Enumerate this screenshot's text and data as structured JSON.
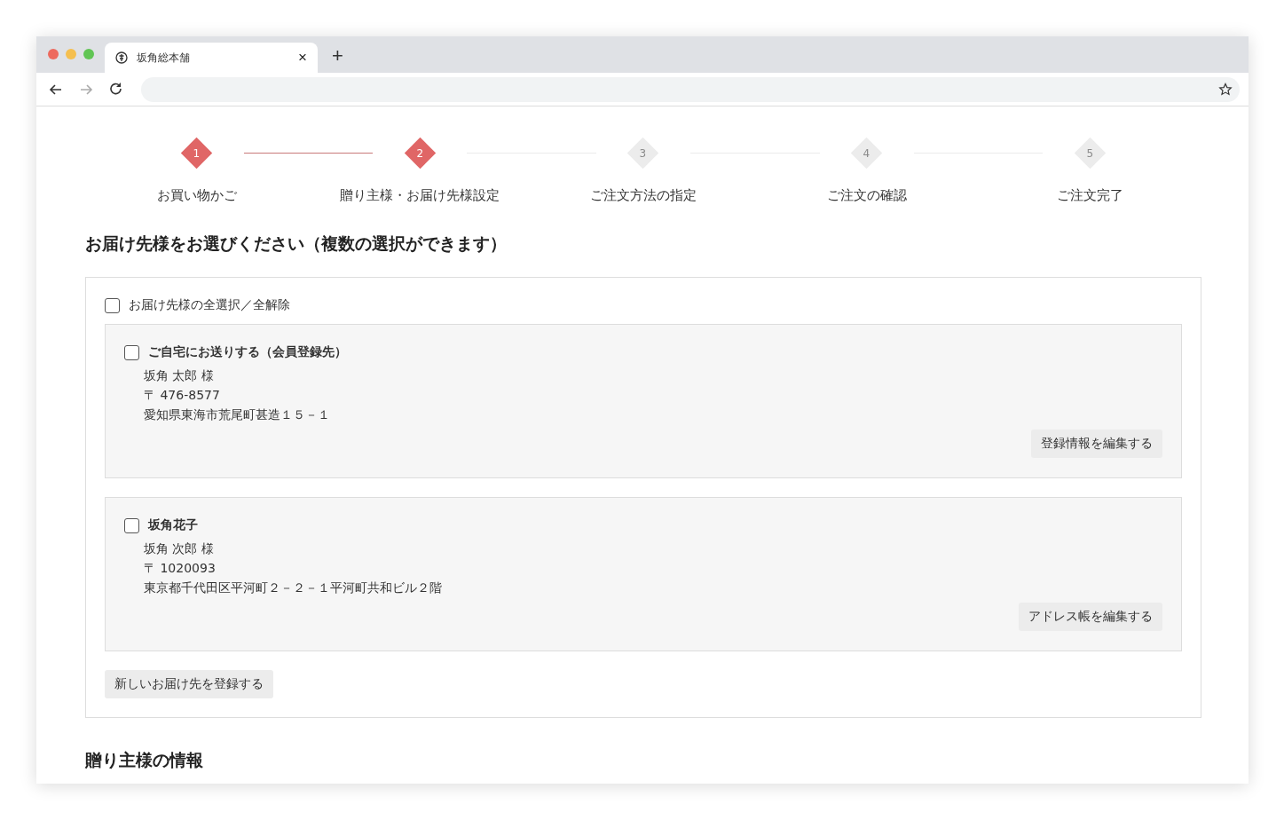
{
  "browser": {
    "tab_title": "坂角総本舗",
    "tab_close": "×",
    "new_tab": "+"
  },
  "steps": [
    {
      "number": "1",
      "label": "お買い物かご",
      "active": true
    },
    {
      "number": "2",
      "label": "贈り主様・お届け先様設定",
      "active": true
    },
    {
      "number": "3",
      "label": "ご注文方法の指定",
      "active": false
    },
    {
      "number": "4",
      "label": "ご注文の確認",
      "active": false
    },
    {
      "number": "5",
      "label": "ご注文完了",
      "active": false
    }
  ],
  "heading": "お届け先様をお選びください（複数の選択ができます）",
  "select_all": {
    "label": "お届け先様の全選択／全解除",
    "checked": false
  },
  "addresses": [
    {
      "title": "ご自宅にお送りする（会員登録先）",
      "checked": false,
      "name": "坂角 太郎 様",
      "postal": "〒 476-8577",
      "address": "愛知県東海市荒尾町甚造１５－１",
      "edit_button": "登録情報を編集する"
    },
    {
      "title": "坂角花子",
      "checked": false,
      "name": "坂角 次郎 様",
      "postal": "〒 1020093",
      "address": "東京都千代田区平河町２－２－１平河町共和ビル２階",
      "edit_button": "アドレス帳を編集する"
    }
  ],
  "add_button": "新しいお届け先を登録する",
  "next_heading": "贈り主様の情報"
}
